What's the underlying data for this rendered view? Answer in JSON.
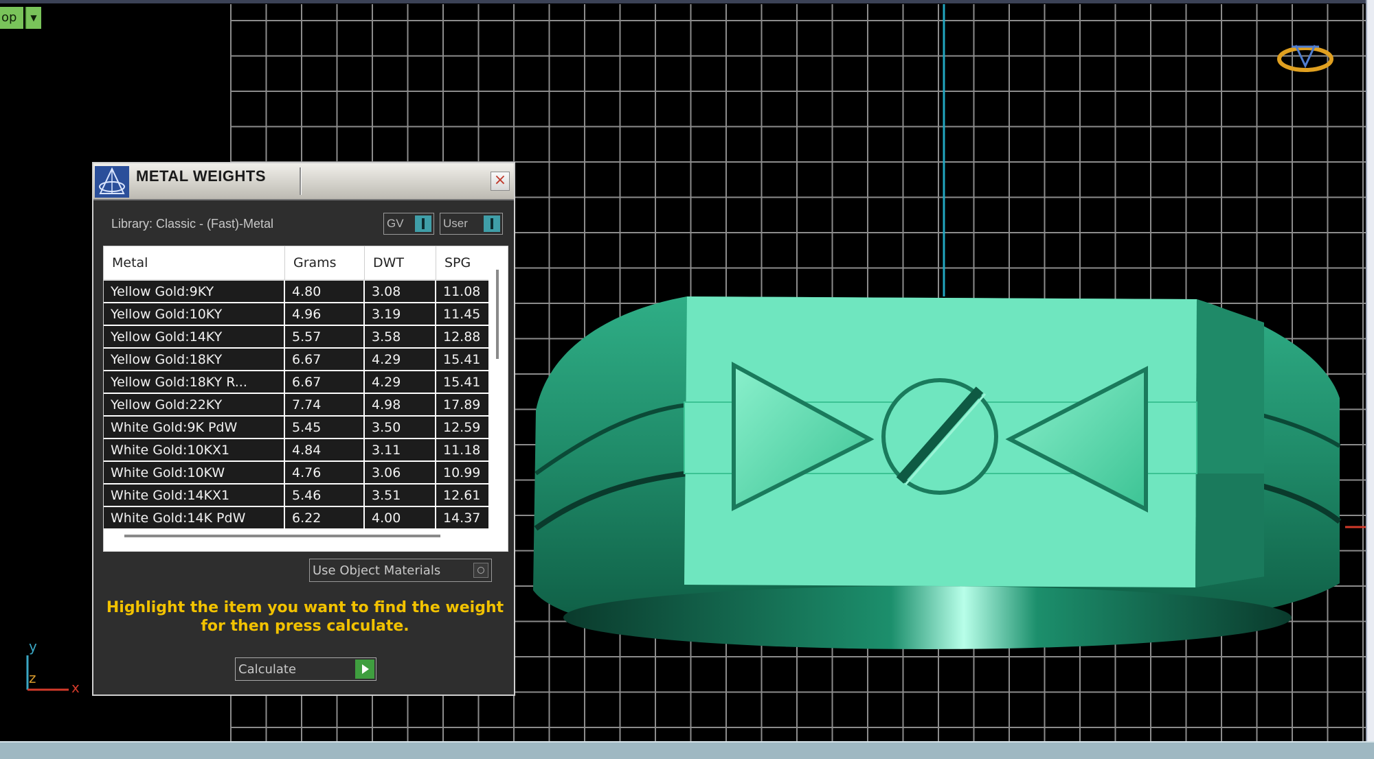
{
  "viewport": {
    "view_label": "op",
    "axes": {
      "x": "x",
      "y": "y",
      "z": "z"
    }
  },
  "dialog": {
    "title": "METAL WEIGHTS",
    "close_symbol": "×",
    "library_label": "Library: Classic - (Fast)-Metal",
    "toggle_gv": "GV",
    "toggle_user": "User",
    "table": {
      "headers": [
        "Metal",
        "Grams",
        "DWT",
        "SPG"
      ],
      "rows": [
        [
          "Yellow Gold:9KY",
          "4.80",
          "3.08",
          "11.08"
        ],
        [
          "Yellow Gold:10KY",
          "4.96",
          "3.19",
          "11.45"
        ],
        [
          "Yellow Gold:14KY",
          "5.57",
          "3.58",
          "12.88"
        ],
        [
          "Yellow Gold:18KY",
          "6.67",
          "4.29",
          "15.41"
        ],
        [
          "Yellow Gold:18KY R...",
          "6.67",
          "4.29",
          "15.41"
        ],
        [
          "Yellow Gold:22KY",
          "7.74",
          "4.98",
          "17.89"
        ],
        [
          "White Gold:9K PdW",
          "5.45",
          "3.50",
          "12.59"
        ],
        [
          "White Gold:10KX1",
          "4.84",
          "3.11",
          "11.18"
        ],
        [
          "White Gold:10KW",
          "4.76",
          "3.06",
          "10.99"
        ],
        [
          "White Gold:14KX1",
          "5.46",
          "3.51",
          "12.61"
        ],
        [
          "White Gold:14K PdW",
          "6.22",
          "4.00",
          "14.37"
        ]
      ]
    },
    "use_object_materials": "Use Object Materials",
    "instructions": "Highlight the item you want to find the weight for then press calculate.",
    "calculate_label": "Calculate"
  },
  "colors": {
    "ring": "#5fe0b4",
    "grid": "#8c8c8c",
    "accent_yellow": "#f2c200",
    "toggle_accent": "#3f9ea8"
  }
}
